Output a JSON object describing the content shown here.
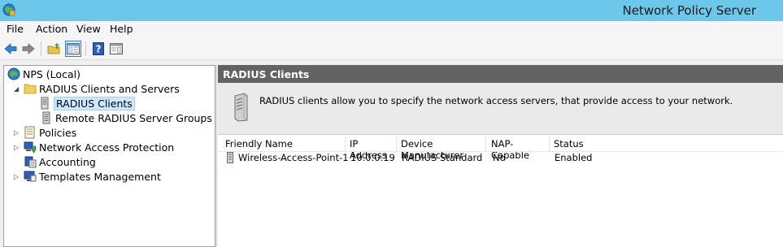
{
  "window": {
    "title": "Network Policy Server"
  },
  "menu": {
    "items": [
      "File",
      "Action",
      "View",
      "Help"
    ]
  },
  "toolbar": {
    "buttons": [
      "back-icon",
      "forward-icon",
      "up-folder-icon",
      "show-hide-console-tree-icon",
      "help-icon",
      "show-hide-action-pane-icon"
    ]
  },
  "tree": {
    "root": "NPS (Local)",
    "radius_group": "RADIUS Clients and Servers",
    "radius_clients": "RADIUS Clients",
    "remote_groups": "Remote RADIUS Server Groups",
    "policies": "Policies",
    "nap": "Network Access Protection",
    "accounting": "Accounting",
    "templates": "Templates Management"
  },
  "pane": {
    "title": "RADIUS Clients",
    "description": "RADIUS clients allow you to specify the network access servers, that provide access to your network."
  },
  "table": {
    "columns": [
      "Friendly Name",
      "IP Address",
      "Device Manufacturer",
      "NAP-Capable",
      "Status"
    ],
    "rows": [
      {
        "name": "Wireless-Access-Point-1",
        "ip": "10.0.0.19",
        "manufacturer": "RADIUS Standard",
        "nap": "No",
        "status": "Enabled"
      }
    ]
  },
  "colors": {
    "titlebar": "#6dc7ea",
    "pane_header": "#636363",
    "selection": "#cce8ff"
  }
}
